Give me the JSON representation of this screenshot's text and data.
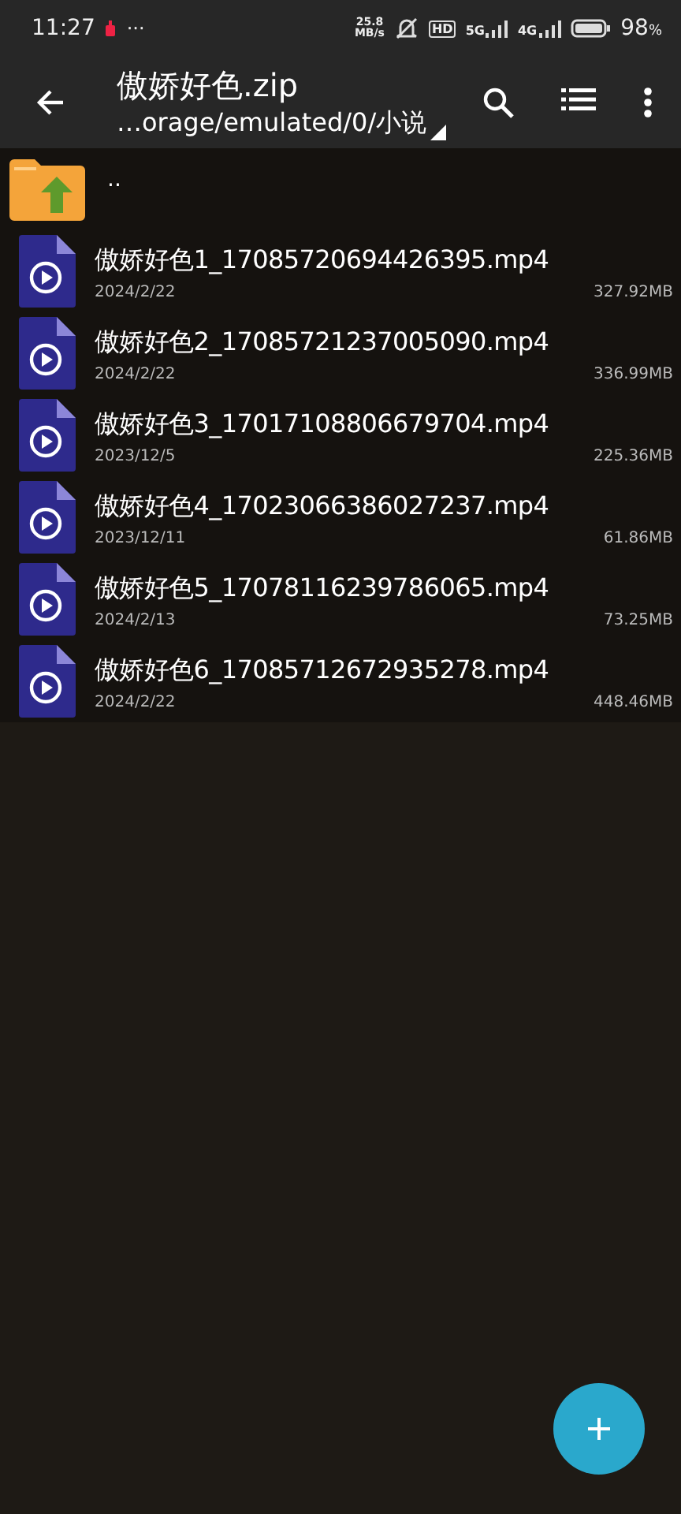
{
  "status_bar": {
    "time": "11:27",
    "more": "···",
    "speed_value": "25.8",
    "speed_unit": "MB/s",
    "hd": "HD",
    "network_5g": "5G",
    "network_4g": "4G",
    "battery": "98",
    "battery_unit": "%"
  },
  "toolbar": {
    "title": "傲娇好色.zip",
    "path": "…orage/emulated/0/小说"
  },
  "parent_entry": {
    "label": ".."
  },
  "files": [
    {
      "name": "傲娇好色1_17085720694426395.mp4",
      "date": "2024/2/22",
      "size": "327.92MB"
    },
    {
      "name": "傲娇好色2_17085721237005090.mp4",
      "date": "2024/2/22",
      "size": "336.99MB"
    },
    {
      "name": "傲娇好色3_17017108806679704.mp4",
      "date": "2023/12/5",
      "size": "225.36MB"
    },
    {
      "name": "傲娇好色4_17023066386027237.mp4",
      "date": "2023/12/11",
      "size": "61.86MB"
    },
    {
      "name": "傲娇好色5_17078116239786065.mp4",
      "date": "2024/2/13",
      "size": "73.25MB"
    },
    {
      "name": "傲娇好色6_17085712672935278.mp4",
      "date": "2024/2/22",
      "size": "448.46MB"
    }
  ]
}
